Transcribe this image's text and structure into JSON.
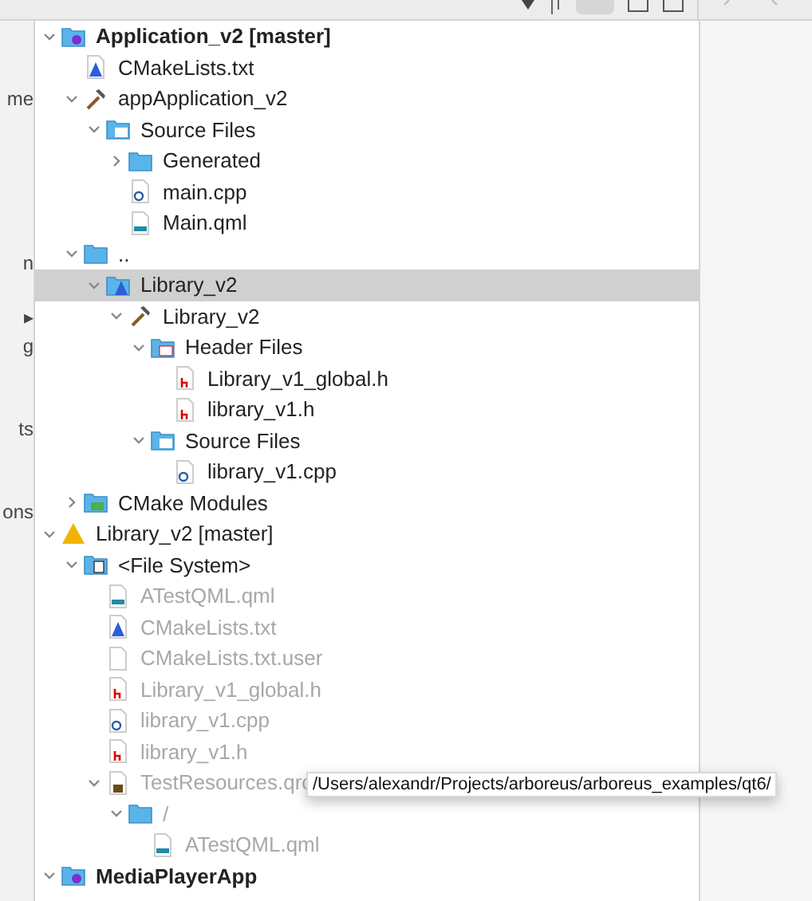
{
  "left_strip": [
    {
      "label": "me"
    },
    {
      "label": "n"
    },
    {
      "label": "▸"
    },
    {
      "label": "g"
    },
    {
      "label": "ts"
    },
    {
      "label": "ons"
    }
  ],
  "tree": [
    {
      "label": "Application_v2 [master]",
      "kind": "project",
      "expanded": true,
      "selected": false,
      "dimmed": false,
      "children": [
        {
          "label": "CMakeLists.txt",
          "kind": "cmake",
          "selected": false,
          "dimmed": false
        },
        {
          "label": "appApplication_v2",
          "kind": "hammer",
          "expanded": true,
          "selected": false,
          "dimmed": false,
          "children": [
            {
              "label": "Source Files",
              "kind": "folder-cpp",
              "expanded": true,
              "selected": false,
              "dimmed": false,
              "children": [
                {
                  "label": "Generated",
                  "kind": "folder",
                  "expanded": false,
                  "selected": false,
                  "dimmed": false
                },
                {
                  "label": "main.cpp",
                  "kind": "cpp",
                  "selected": false,
                  "dimmed": false
                },
                {
                  "label": "Main.qml",
                  "kind": "qml",
                  "selected": false,
                  "dimmed": false
                }
              ]
            }
          ]
        },
        {
          "label": "..",
          "kind": "folder",
          "expanded": true,
          "selected": false,
          "dimmed": false,
          "children": [
            {
              "label": "Library_v2",
              "kind": "folder-cmake",
              "expanded": true,
              "selected": true,
              "dimmed": false,
              "children": [
                {
                  "label": "Library_v2",
                  "kind": "hammer",
                  "expanded": true,
                  "selected": false,
                  "dimmed": false,
                  "children": [
                    {
                      "label": "Header Files",
                      "kind": "folder-h",
                      "expanded": true,
                      "selected": false,
                      "dimmed": false,
                      "children": [
                        {
                          "label": "Library_v1_global.h",
                          "kind": "h",
                          "selected": false,
                          "dimmed": false
                        },
                        {
                          "label": "library_v1.h",
                          "kind": "h",
                          "selected": false,
                          "dimmed": false
                        }
                      ]
                    },
                    {
                      "label": "Source Files",
                      "kind": "folder-cpp",
                      "expanded": true,
                      "selected": false,
                      "dimmed": false,
                      "children": [
                        {
                          "label": "library_v1.cpp",
                          "kind": "cpp",
                          "selected": false,
                          "dimmed": false
                        }
                      ]
                    }
                  ]
                }
              ]
            }
          ]
        },
        {
          "label": "CMake Modules",
          "kind": "modules",
          "expanded": false,
          "selected": false,
          "dimmed": false
        }
      ]
    },
    {
      "label": "Library_v2 [master]",
      "kind": "warning",
      "expanded": true,
      "selected": false,
      "dimmed": false,
      "children": [
        {
          "label": "<File System>",
          "kind": "filesystem",
          "expanded": true,
          "selected": false,
          "dimmed": false,
          "children": [
            {
              "label": "ATestQML.qml",
              "kind": "qml",
              "selected": false,
              "dimmed": true
            },
            {
              "label": "CMakeLists.txt",
              "kind": "cmake",
              "selected": false,
              "dimmed": true
            },
            {
              "label": "CMakeLists.txt.user",
              "kind": "file",
              "selected": false,
              "dimmed": true
            },
            {
              "label": "Library_v1_global.h",
              "kind": "h",
              "selected": false,
              "dimmed": true
            },
            {
              "label": "library_v1.cpp",
              "kind": "cpp",
              "selected": false,
              "dimmed": true
            },
            {
              "label": "library_v1.h",
              "kind": "h",
              "selected": false,
              "dimmed": true
            },
            {
              "label": "TestResources.qrc",
              "kind": "qrc",
              "expanded": true,
              "selected": false,
              "dimmed": true,
              "children": [
                {
                  "label": "/",
                  "kind": "folder",
                  "expanded": true,
                  "selected": false,
                  "dimmed": true,
                  "children": [
                    {
                      "label": "ATestQML.qml",
                      "kind": "qml",
                      "selected": false,
                      "dimmed": true
                    }
                  ]
                }
              ]
            }
          ]
        }
      ]
    },
    {
      "label": "MediaPlayerApp",
      "kind": "project",
      "expanded": true,
      "selected": false,
      "dimmed": false
    }
  ],
  "tooltip": {
    "text": "/Users/alexandr/Projects/arboreus/arboreus_examples/qt6/"
  }
}
